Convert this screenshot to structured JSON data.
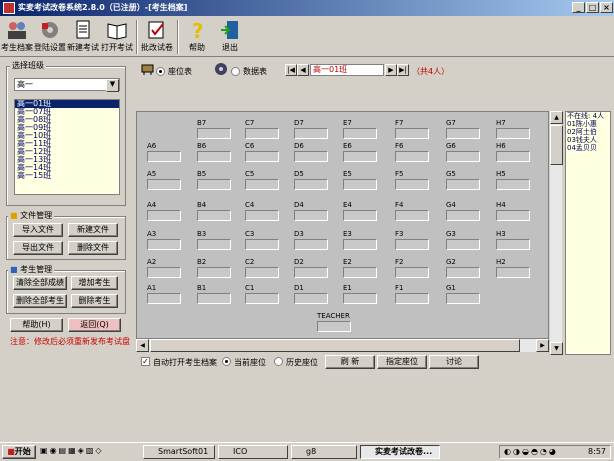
{
  "window": {
    "title": "实麦考试改卷系统2.8.0（已注册）-[考生档案]"
  },
  "toolbar": [
    {
      "label": "考生档案",
      "icon": "people-icon"
    },
    {
      "label": "登陆设置",
      "icon": "settings-icon"
    },
    {
      "label": "新建考试",
      "icon": "document-icon"
    },
    {
      "label": "打开考试",
      "icon": "open-book-icon"
    },
    {
      "label": "批改试卷",
      "icon": "grade-icon"
    },
    {
      "label": "帮助",
      "icon": "help-icon"
    },
    {
      "label": "退出",
      "icon": "exit-icon"
    }
  ],
  "left": {
    "select_class_label": "选择班级",
    "grade_combo": "高一",
    "classes": [
      "高一01班",
      "高一07班",
      "高一08班",
      "高一09班",
      "高一10班",
      "高一11班",
      "高一12班",
      "高一13班",
      "高一14班",
      "高一15班"
    ],
    "file_group": "文件管理",
    "file_buttons": [
      "导入文件",
      "新建文件",
      "导出文件",
      "删除文件"
    ],
    "student_group": "考生管理",
    "student_buttons": [
      "清除全部成绩",
      "增加考生",
      "删除全部考生",
      "删除考生"
    ],
    "help_button": "帮助(H)",
    "back_button": "返回(Q)",
    "note": "注意：修改后必须重新发布考试盘"
  },
  "view": {
    "seat_option": "座位表",
    "data_option": "数据表",
    "class_field": "高一01班",
    "count_text": "（共4人）"
  },
  "seats": {
    "A": [
      "A1",
      "A2",
      "A3",
      "A4",
      "A5",
      "A6"
    ],
    "B": [
      "B1",
      "B2",
      "B3",
      "B4",
      "B5",
      "B6",
      "B7"
    ],
    "C": [
      "C1",
      "C2",
      "C3",
      "C4",
      "C5",
      "C6",
      "C7"
    ],
    "D": [
      "D1",
      "D2",
      "D3",
      "D4",
      "D5",
      "D6",
      "D7"
    ],
    "E": [
      "E1",
      "E2",
      "E3",
      "E4",
      "E5",
      "E6",
      "E7"
    ],
    "F": [
      "F1",
      "F2",
      "F3",
      "F4",
      "F5",
      "F6",
      "F7"
    ],
    "G": [
      "G1",
      "G2",
      "G3",
      "G4",
      "G5",
      "G6",
      "G7"
    ],
    "H": [
      "H2",
      "H3",
      "H4",
      "H5",
      "H6",
      "H7"
    ],
    "teacher": "TEACHER"
  },
  "absent": {
    "title": "不在线: 4人",
    "list": [
      "01陈小惠",
      "02阿土伯",
      "03钱夫人",
      "04孟贝贝"
    ]
  },
  "bottom": {
    "auto_open_label": "自动打开考生档案",
    "current_seat_label": "当前座位",
    "history_seat_label": "历史座位",
    "refresh_button": "刷 新",
    "assign_button": "指定座位",
    "discuss_button": "讨论"
  },
  "taskbar": {
    "start": "开始",
    "items": [
      "SmartSoft01",
      "ICO",
      "g8",
      "实麦考试改卷..."
    ],
    "clock": "8:57"
  }
}
